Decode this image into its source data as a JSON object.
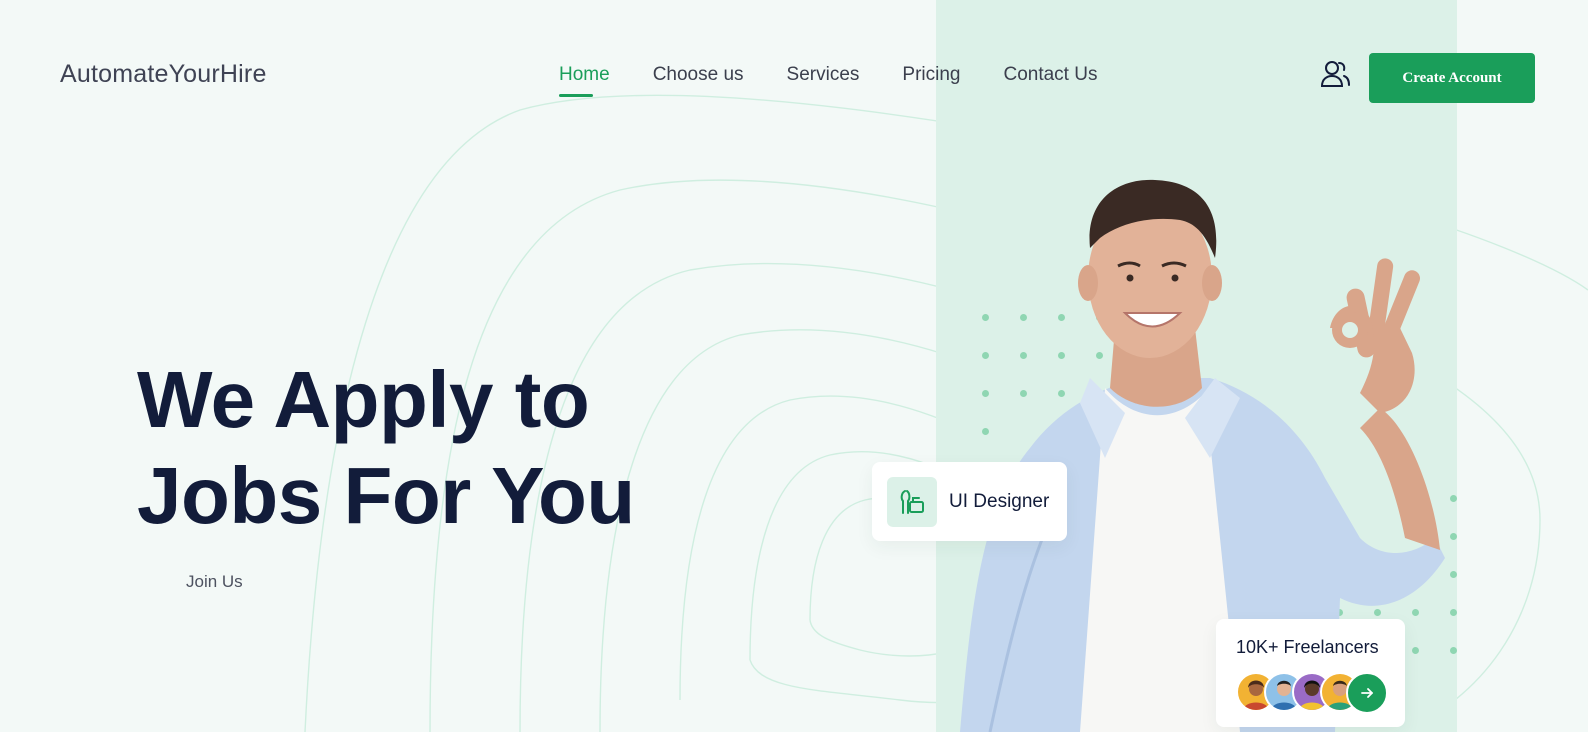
{
  "brand": {
    "name": "AutomateYourHire"
  },
  "nav": {
    "items": [
      {
        "label": "Home",
        "active": true
      },
      {
        "label": "Choose us",
        "active": false
      },
      {
        "label": "Services",
        "active": false
      },
      {
        "label": "Pricing",
        "active": false
      },
      {
        "label": "Contact Us",
        "active": false
      }
    ]
  },
  "header": {
    "account_icon": "users-icon",
    "cta_label": "Create Account"
  },
  "hero": {
    "title_line1": "We Apply to",
    "title_line2": "Jobs For You",
    "join_label": "Join Us"
  },
  "cards": {
    "role": {
      "icon": "design-tools-icon",
      "label": "UI Designer"
    },
    "freelancers": {
      "title": "10K+ Freelancers",
      "arrow_icon": "arrow-right-icon"
    }
  },
  "colors": {
    "accent": "#1a9e5a",
    "panel": "#dcf1e8",
    "background": "#f3f9f7",
    "heading": "#121c3a"
  }
}
